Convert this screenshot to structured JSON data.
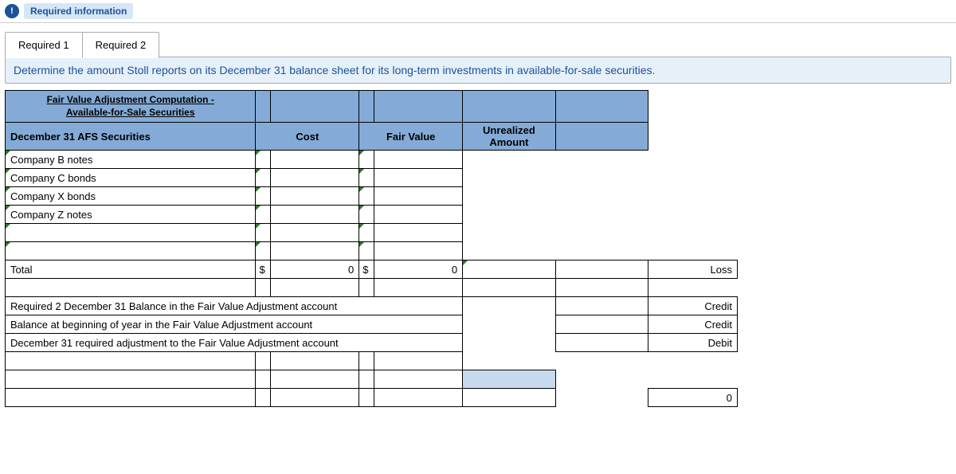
{
  "header": {
    "pill": "Required information",
    "icon_glyph": "!"
  },
  "tabs": {
    "t1": "Required 1",
    "t2": "Required 2"
  },
  "prompt": "Determine the amount Stoll reports on its December 31 balance sheet for its long-term investments in available-for-sale securities.",
  "table": {
    "title_line1": "Fair Value Adjustment Computation -",
    "title_line2": "Available-for-Sale Securities",
    "hdr_sec": "December 31 AFS Securities",
    "hdr_cost": "Cost",
    "hdr_fv": "Fair Value",
    "hdr_ua": "Unrealized Amount",
    "rows": {
      "r1": "Company B notes",
      "r2": "Company C bonds",
      "r3": "Company X bonds",
      "r4": "Company Z notes"
    },
    "total_label": "Total",
    "dollar": "$",
    "zero": "0",
    "loss": "Loss",
    "req2": "Required 2 December 31 Balance in the Fair Value Adjustment account",
    "beg": "Balance at beginning of year in the Fair Value Adjustment account",
    "adj": "December 31 required adjustment to the Fair Value Adjustment account",
    "credit": "Credit",
    "debit": "Debit",
    "final_zero": "0"
  }
}
